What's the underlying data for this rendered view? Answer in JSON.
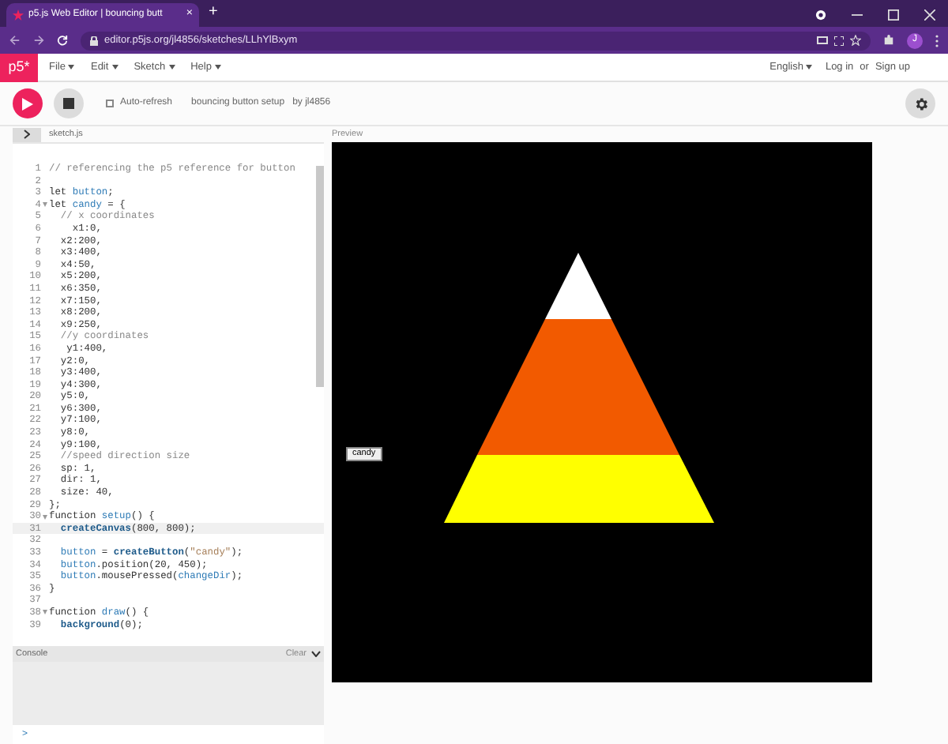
{
  "browser": {
    "tab_title": "p5.js Web Editor | bouncing butt",
    "tab_close": "×",
    "new_tab": "+",
    "address": "editor.p5js.org/jl4856/sketches/LLhYlBxym",
    "profile": "J"
  },
  "nav": {
    "logo": "p5*",
    "menus": [
      "File",
      "Edit",
      "Sketch",
      "Help"
    ],
    "language": "English",
    "login": "Log in",
    "or": "or",
    "signup": "Sign up"
  },
  "toolbar": {
    "auto_refresh": {
      "label": "Auto-refresh",
      "checked": false
    },
    "sketch_name": "bouncing button setup",
    "author": "by jl4856"
  },
  "editor": {
    "file_tab": "sketch.js",
    "lines": [
      {
        "n": "1",
        "fold": false,
        "active": false,
        "tokens": [
          {
            "kind": "comment",
            "text": "// referencing the p5 reference for button"
          }
        ]
      },
      {
        "n": "2",
        "fold": false,
        "active": false
      },
      {
        "n": "3",
        "fold": false,
        "active": false,
        "tokens": [
          {
            "kind": "plain",
            "text": "let "
          },
          {
            "kind": "variable",
            "text": "button"
          },
          {
            "kind": "plain",
            "text": ";"
          }
        ]
      },
      {
        "n": "4",
        "fold": true,
        "active": false,
        "tokens": [
          {
            "kind": "plain",
            "text": "let "
          },
          {
            "kind": "variable",
            "text": "candy"
          },
          {
            "kind": "plain",
            "text": " = {"
          }
        ]
      },
      {
        "n": "5",
        "fold": false,
        "active": false,
        "tokens": [
          {
            "kind": "comment",
            "text": "  // x coordinates"
          }
        ]
      },
      {
        "n": "6",
        "fold": false,
        "active": false,
        "tokens": [
          {
            "kind": "plain",
            "text": "    x1:0,"
          }
        ]
      },
      {
        "n": "7",
        "fold": false,
        "active": false,
        "tokens": [
          {
            "kind": "plain",
            "text": "  x2:200,"
          }
        ]
      },
      {
        "n": "8",
        "fold": false,
        "active": false,
        "tokens": [
          {
            "kind": "plain",
            "text": "  x3:400,"
          }
        ]
      },
      {
        "n": "9",
        "fold": false,
        "active": false,
        "tokens": [
          {
            "kind": "plain",
            "text": "  x4:50,"
          }
        ]
      },
      {
        "n": "10",
        "fold": false,
        "active": false,
        "tokens": [
          {
            "kind": "plain",
            "text": "  x5:200,"
          }
        ]
      },
      {
        "n": "11",
        "fold": false,
        "active": false,
        "tokens": [
          {
            "kind": "plain",
            "text": "  x6:350,"
          }
        ]
      },
      {
        "n": "12",
        "fold": false,
        "active": false,
        "tokens": [
          {
            "kind": "plain",
            "text": "  x7:150,"
          }
        ]
      },
      {
        "n": "13",
        "fold": false,
        "active": false,
        "tokens": [
          {
            "kind": "plain",
            "text": "  x8:200,"
          }
        ]
      },
      {
        "n": "14",
        "fold": false,
        "active": false,
        "tokens": [
          {
            "kind": "plain",
            "text": "  x9:250,"
          }
        ]
      },
      {
        "n": "15",
        "fold": false,
        "active": false,
        "tokens": [
          {
            "kind": "comment",
            "text": "  //y coordinates"
          }
        ]
      },
      {
        "n": "16",
        "fold": false,
        "active": false,
        "tokens": [
          {
            "kind": "plain",
            "text": "   y1:400,"
          }
        ]
      },
      {
        "n": "17",
        "fold": false,
        "active": false,
        "tokens": [
          {
            "kind": "plain",
            "text": "  y2:0,"
          }
        ]
      },
      {
        "n": "18",
        "fold": false,
        "active": false,
        "tokens": [
          {
            "kind": "plain",
            "text": "  y3:400,"
          }
        ]
      },
      {
        "n": "19",
        "fold": false,
        "active": false,
        "tokens": [
          {
            "kind": "plain",
            "text": "  y4:300,"
          }
        ]
      },
      {
        "n": "20",
        "fold": false,
        "active": false,
        "tokens": [
          {
            "kind": "plain",
            "text": "  y5:0,"
          }
        ]
      },
      {
        "n": "21",
        "fold": false,
        "active": false,
        "tokens": [
          {
            "kind": "plain",
            "text": "  y6:300,"
          }
        ]
      },
      {
        "n": "22",
        "fold": false,
        "active": false,
        "tokens": [
          {
            "kind": "plain",
            "text": "  y7:100,"
          }
        ]
      },
      {
        "n": "23",
        "fold": false,
        "active": false,
        "tokens": [
          {
            "kind": "plain",
            "text": "  y8:0,"
          }
        ]
      },
      {
        "n": "24",
        "fold": false,
        "active": false,
        "tokens": [
          {
            "kind": "plain",
            "text": "  y9:100,"
          }
        ]
      },
      {
        "n": "25",
        "fold": false,
        "active": false,
        "tokens": [
          {
            "kind": "comment",
            "text": "  //speed direction size"
          }
        ]
      },
      {
        "n": "26",
        "fold": false,
        "active": false,
        "tokens": [
          {
            "kind": "plain",
            "text": "  sp: 1,"
          }
        ]
      },
      {
        "n": "27",
        "fold": false,
        "active": false,
        "tokens": [
          {
            "kind": "plain",
            "text": "  dir: 1,"
          }
        ]
      },
      {
        "n": "28",
        "fold": false,
        "active": false,
        "tokens": [
          {
            "kind": "plain",
            "text": "  size: 40,"
          }
        ]
      },
      {
        "n": "29",
        "fold": false,
        "active": false,
        "tokens": [
          {
            "kind": "plain",
            "text": "};"
          }
        ]
      },
      {
        "n": "30",
        "fold": true,
        "active": false,
        "tokens": [
          {
            "kind": "plain",
            "text": "function "
          },
          {
            "kind": "variable",
            "text": "setup"
          },
          {
            "kind": "plain",
            "text": "() {"
          }
        ]
      },
      {
        "n": "31",
        "fold": false,
        "active": true,
        "tokens": [
          {
            "kind": "builtin",
            "text": "  createCanvas"
          },
          {
            "kind": "plain",
            "text": "(800, 800);"
          }
        ]
      },
      {
        "n": "32",
        "fold": false,
        "active": false
      },
      {
        "n": "33",
        "fold": false,
        "active": false,
        "tokens": [
          {
            "kind": "variable",
            "text": "  button"
          },
          {
            "kind": "plain",
            "text": " = "
          },
          {
            "kind": "builtin",
            "text": "createButton"
          },
          {
            "kind": "plain",
            "text": "("
          },
          {
            "kind": "string",
            "text": "\"candy\""
          },
          {
            "kind": "plain",
            "text": ");"
          }
        ]
      },
      {
        "n": "34",
        "fold": false,
        "active": false,
        "tokens": [
          {
            "kind": "variable",
            "text": "  button"
          },
          {
            "kind": "plain",
            "text": ".position(20, 450);"
          }
        ]
      },
      {
        "n": "35",
        "fold": false,
        "active": false,
        "tokens": [
          {
            "kind": "variable",
            "text": "  button"
          },
          {
            "kind": "plain",
            "text": ".mousePressed("
          },
          {
            "kind": "variable",
            "text": "changeDir"
          },
          {
            "kind": "plain",
            "text": ");"
          }
        ]
      },
      {
        "n": "36",
        "fold": false,
        "active": false,
        "tokens": [
          {
            "kind": "plain",
            "text": "}"
          }
        ]
      },
      {
        "n": "37",
        "fold": false,
        "active": false
      },
      {
        "n": "38",
        "fold": true,
        "active": false,
        "tokens": [
          {
            "kind": "plain",
            "text": "function "
          },
          {
            "kind": "variable",
            "text": "draw"
          },
          {
            "kind": "plain",
            "text": "() {"
          }
        ]
      },
      {
        "n": "39",
        "fold": false,
        "active": false,
        "tokens": [
          {
            "kind": "builtin",
            "text": "  background"
          },
          {
            "kind": "plain",
            "text": "(0);"
          }
        ]
      }
    ]
  },
  "console": {
    "title": "Console",
    "clear": "Clear",
    "prompt": ">"
  },
  "preview": {
    "title": "Preview",
    "canvas_button": "candy"
  }
}
